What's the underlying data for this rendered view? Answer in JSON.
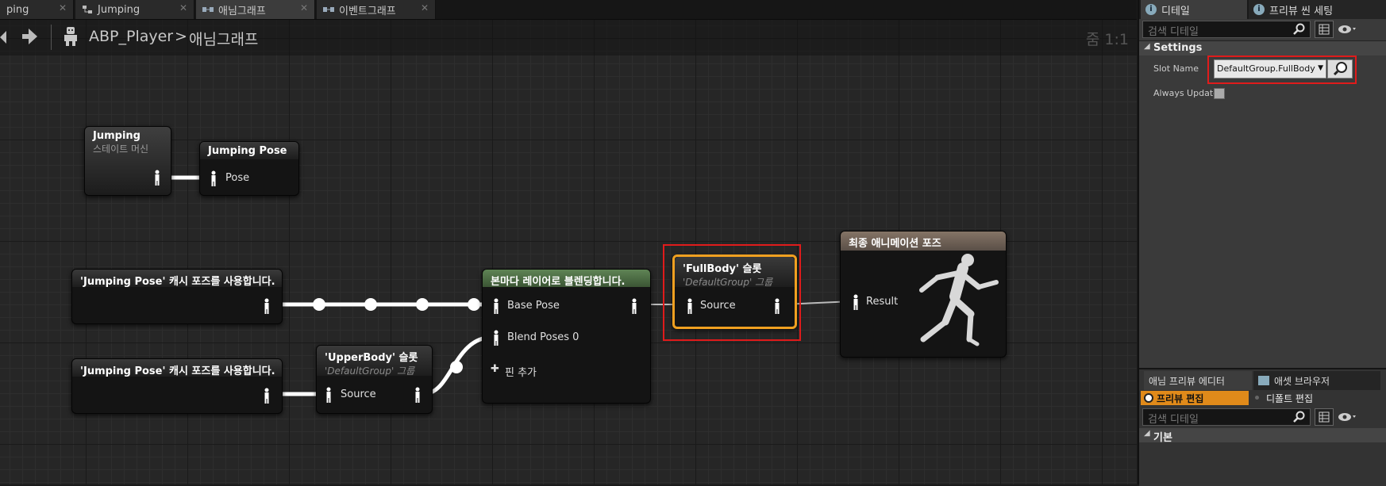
{
  "tabs": [
    {
      "label": "ping",
      "icon": "blueprint-icon"
    },
    {
      "label": "Jumping",
      "icon": "state-machine-icon"
    },
    {
      "label": "애님그래프",
      "icon": "graph-icon"
    },
    {
      "label": "이벤트그래프",
      "icon": "graph-icon"
    }
  ],
  "breadcrumb": {
    "blueprint": "ABP_Player",
    "separator": ">",
    "graph": "애님그래프"
  },
  "zoom_label": "줌 1:1",
  "nodes": {
    "jumping_sm": {
      "title": "Jumping",
      "subtitle": "스테이트 머신"
    },
    "jumping_pose": {
      "title": "Jumping Pose",
      "pin": "Pose"
    },
    "cache1": {
      "title": "'Jumping Pose' 캐시 포즈를 사용합니다."
    },
    "cache2": {
      "title": "'Jumping Pose' 캐시 포즈를 사용합니다."
    },
    "upper_slot": {
      "title": "'UpperBody' 슬롯",
      "subtitle": "'DefaultGroup' 그룹",
      "pin": "Source"
    },
    "blend": {
      "title": "본마다 레이어로 블렌딩합니다.",
      "pin_base": "Base Pose",
      "pin_blend": "Blend Poses 0",
      "add_pin": "핀 추가"
    },
    "full_slot": {
      "title": "'FullBody' 슬롯",
      "subtitle": "'DefaultGroup' 그룹",
      "pin": "Source"
    },
    "output": {
      "title": "최종 애니메이션 포즈",
      "pin": "Result"
    }
  },
  "details": {
    "tabs": [
      "디테일",
      "프리뷰 씬 세팅"
    ],
    "search_placeholder": "검색 디테일",
    "section": "Settings",
    "slot_name_label": "Slot Name",
    "slot_name_value": "DefaultGroup.FullBody",
    "always_update_label": "Always Update",
    "always_update_checked": false
  },
  "bottom_panel": {
    "tabs": [
      "애님 프리뷰 에디터",
      "애셋 브라우저"
    ],
    "mode_preview": "프리뷰 편집",
    "mode_default": "디폴트 편집",
    "search_placeholder": "검색 디테일",
    "section": "기본"
  },
  "colors": {
    "highlight": "#e01b1b",
    "selected_node": "#f0a020",
    "blend_header": "#4d6b44",
    "output_header": "#6e6159",
    "active_mode": "#e08a1a"
  }
}
